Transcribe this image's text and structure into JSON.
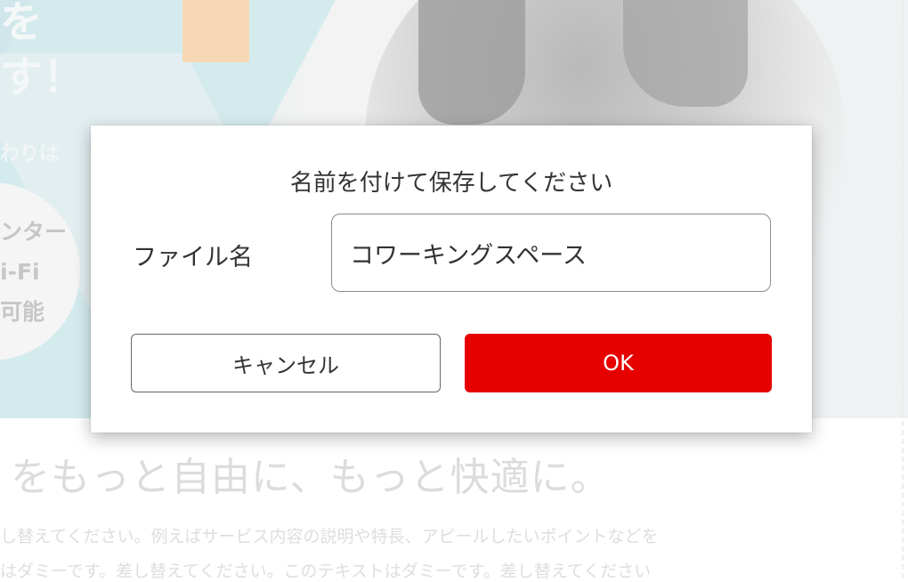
{
  "background": {
    "hero_heading_lines": [
      "を",
      "す！"
    ],
    "hero_subtext": "わりは",
    "circle_lines": [
      "ンター",
      "i-Fi",
      "可能"
    ],
    "headline": "をもっと自由に、もっと快適に。",
    "body_line_1": "し替えてください。例えばサービス内容の説明や特長、アピールしたいポイントなどを",
    "body_line_2": "はダミーです。差し替えてください。このテキストはダミーです。差し替えてください"
  },
  "dialog": {
    "title": "名前を付けて保存してください",
    "file_label": "ファイル名",
    "file_value": "コワーキングスペース",
    "cancel_label": "キャンセル",
    "ok_label": "OK"
  },
  "colors": {
    "ok_button": "#e60000",
    "text": "#333333"
  }
}
